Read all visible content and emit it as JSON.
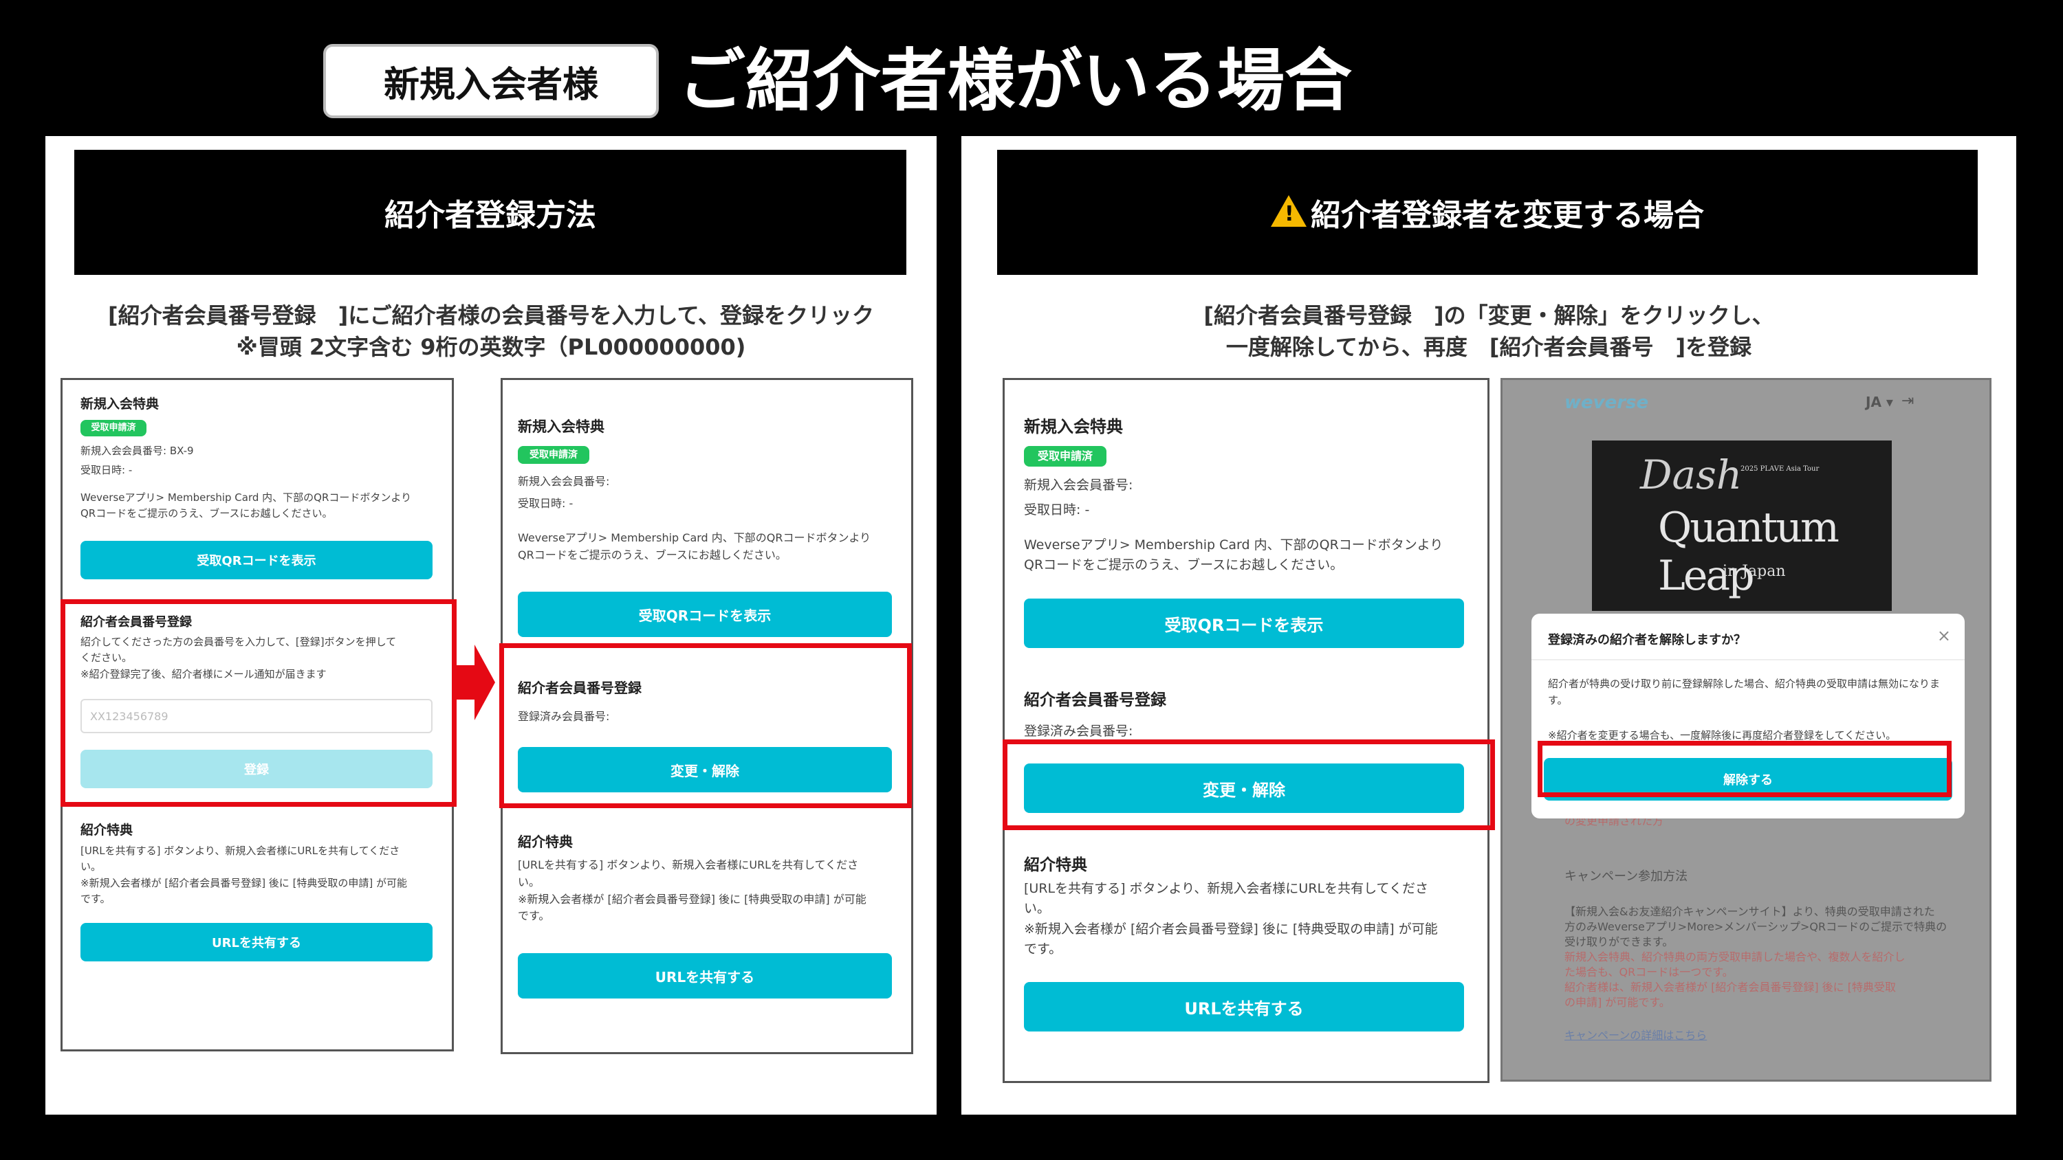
{
  "header": {
    "badge": "新規入会者様",
    "title": "ご紹介者様がいる場合"
  },
  "left_panel": {
    "heading": "紹介者登録方法",
    "instruction_line1": "[紹介者会員番号登録　]にご紹介者様の会員番号を入力して、登録をクリック",
    "instruction_line2": "※冒頭 2文字含む 9桁の英数字（PL000000000)",
    "screen_a": {
      "benefit_title": "新規入会特典",
      "status_tag": "受取申請済",
      "member_no": "新規入会会員番号: BX-9",
      "received_date": "受取日時: -",
      "guide": "Weverseアプリ> Membership Card 内、下部のQRコードボタンより\nQRコードをご提示のうえ、ブースにお越しください。",
      "qr_button": "受取QRコードを表示",
      "referrer_title": "紹介者会員番号登録",
      "referrer_desc": "紹介してくださった方の会員番号を入力して、[登録]ボタンを押して\nください。\n※紹介登録完了後、紹介者様にメール通知が届きます",
      "input_placeholder": "XX123456789",
      "register_button": "登録",
      "ref_benefit_title": "紹介特典",
      "ref_benefit_desc": "[URLを共有する] ボタンより、新規入会者様にURLを共有してくださ\nい。\n※新規入会者様が [紹介者会員番号登録] 後に [特典受取の申請] が可能\nです。",
      "share_button": "URLを共有する"
    },
    "screen_b": {
      "benefit_title": "新規入会特典",
      "status_tag": "受取申請済",
      "member_no": "新規入会会員番号:",
      "received_date": "受取日時: -",
      "guide": "Weverseアプリ> Membership Card 内、下部のQRコードボタンより\nQRコードをご提示のうえ、ブースにお越しください。",
      "qr_button": "受取QRコードを表示",
      "referrer_title": "紹介者会員番号登録",
      "registered_no": "登録済み会員番号:",
      "change_button": "変更・解除",
      "ref_benefit_title": "紹介特典",
      "ref_benefit_desc": "[URLを共有する] ボタンより、新規入会者様にURLを共有してくださ\nい。\n※新規入会者様が [紹介者会員番号登録] 後に [特典受取の申請] が可能\nです。",
      "share_button": "URLを共有する"
    }
  },
  "right_panel": {
    "heading": "紹介者登録者を変更する場合",
    "instruction_line1": "[紹介者会員番号登録　]の「変更・解除」をクリックし、",
    "instruction_line2": "一度解除してから、再度　[紹介者会員番号　]を登録",
    "screen_c": {
      "benefit_title": "新規入会特典",
      "status_tag": "受取申請済",
      "member_no": "新規入会会員番号:",
      "received_date": "受取日時: -",
      "guide": "Weverseアプリ> Membership Card 内、下部のQRコードボタンより\nQRコードをご提示のうえ、ブースにお越しください。",
      "qr_button": "受取QRコードを表示",
      "referrer_title": "紹介者会員番号登録",
      "registered_no": "登録済み会員番号:",
      "change_button": "変更・解除",
      "ref_benefit_title": "紹介特典",
      "ref_benefit_desc": "[URLを共有する] ボタンより、新規入会者様にURLを共有してくださ\nい。\n※新規入会者様が [紹介者会員番号登録] 後に [特典受取の申請] が可能\nです。",
      "share_button": "URLを共有する"
    },
    "weverse": {
      "logo": "weverse",
      "lang": "JA ▾",
      "poster_script": "Dash",
      "poster_tour": "2025 PLAVE Asia Tour",
      "poster_title": "Quantum Leap",
      "poster_sub": "in Japan",
      "modal_title": "登録済みの紹介者を解除しますか？",
      "modal_body": "紹介者が特典の受け取り前に登録解除した場合、紹介特典の受取申請は無効になります。",
      "modal_note": "※紹介者を変更する場合も、一度解除後に再度紹介者登録をしてください。",
      "modal_button": "解除する",
      "bg_note": "の変更申請された方",
      "campaign_title": "キャンペーン参加方法",
      "campaign_l1": "【新規入会&お友達紹介キャンペーンサイト】より、特典の受取申請された",
      "campaign_l2": "方のみWeverseアプリ>More>メンバーシップ>QRコードのご提示で特典の",
      "campaign_l3": "受け取りができます。",
      "campaign_l4": "新規入会特典、紹介特典の両方受取申請した場合や、複数人を紹介し",
      "campaign_l5": "た場合も、QRコードは一つです。",
      "campaign_l6": "紹介者様は、新規入会者様が [紹介者会員番号登録] 後に [特典受取",
      "campaign_l7": "の申請] が可能です。",
      "campaign_link": "キャンペーンの詳細はこちら"
    }
  },
  "colors": {
    "accent": "#00bcd4",
    "status_green": "#22c55e",
    "highlight_red": "#e50914",
    "warning_yellow": "#f5b800"
  }
}
